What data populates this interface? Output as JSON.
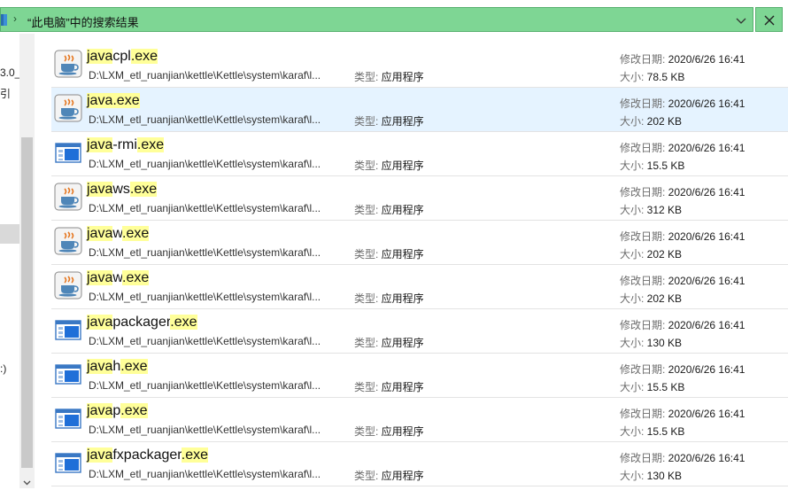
{
  "location": {
    "text": "“此电脑”中的搜索结果",
    "separator": "›"
  },
  "nav": {
    "fragments": [
      "3.0_",
      "引",
      ":)"
    ]
  },
  "labels": {
    "type": "类型: ",
    "modified": "修改日期: ",
    "size": "大小: "
  },
  "files": [
    {
      "name_parts": [
        {
          "t": "java",
          "hl": true
        },
        {
          "t": "cpl",
          "hl": false
        },
        {
          "t": ".exe",
          "hl": true
        }
      ],
      "icon": "java-cup-icon",
      "path": "D:\\LXM_etl_ruanjian\\kettle\\Kettle\\system\\karaf\\l...",
      "type": "应用程序",
      "modified": "2020/6/26 16:41",
      "size": "78.5 KB",
      "selected": false
    },
    {
      "name_parts": [
        {
          "t": "java",
          "hl": true
        },
        {
          "t": ".exe",
          "hl": true
        }
      ],
      "icon": "java-cup-icon",
      "path": "D:\\LXM_etl_ruanjian\\kettle\\Kettle\\system\\karaf\\l...",
      "type": "应用程序",
      "modified": "2020/6/26 16:41",
      "size": "202 KB",
      "selected": true
    },
    {
      "name_parts": [
        {
          "t": "java",
          "hl": true
        },
        {
          "t": "-rmi",
          "hl": false
        },
        {
          "t": ".exe",
          "hl": true
        }
      ],
      "icon": "window-app-icon",
      "path": "D:\\LXM_etl_ruanjian\\kettle\\Kettle\\system\\karaf\\l...",
      "type": "应用程序",
      "modified": "2020/6/26 16:41",
      "size": "15.5 KB",
      "selected": false
    },
    {
      "name_parts": [
        {
          "t": "java",
          "hl": true
        },
        {
          "t": "ws",
          "hl": false
        },
        {
          "t": ".exe",
          "hl": true
        }
      ],
      "icon": "java-cup-icon",
      "path": "D:\\LXM_etl_ruanjian\\kettle\\Kettle\\system\\karaf\\l...",
      "type": "应用程序",
      "modified": "2020/6/26 16:41",
      "size": "312 KB",
      "selected": false
    },
    {
      "name_parts": [
        {
          "t": "java",
          "hl": true
        },
        {
          "t": "w",
          "hl": false
        },
        {
          "t": ".exe",
          "hl": true
        }
      ],
      "icon": "java-cup-icon",
      "path": "D:\\LXM_etl_ruanjian\\kettle\\Kettle\\system\\karaf\\l...",
      "type": "应用程序",
      "modified": "2020/6/26 16:41",
      "size": "202 KB",
      "selected": false
    },
    {
      "name_parts": [
        {
          "t": "java",
          "hl": true
        },
        {
          "t": "w",
          "hl": false
        },
        {
          "t": ".exe",
          "hl": true
        }
      ],
      "icon": "java-cup-icon",
      "path": "D:\\LXM_etl_ruanjian\\kettle\\Kettle\\system\\karaf\\l...",
      "type": "应用程序",
      "modified": "2020/6/26 16:41",
      "size": "202 KB",
      "selected": false
    },
    {
      "name_parts": [
        {
          "t": "java",
          "hl": true
        },
        {
          "t": "packager",
          "hl": false
        },
        {
          "t": ".exe",
          "hl": true
        }
      ],
      "icon": "window-app-icon",
      "path": "D:\\LXM_etl_ruanjian\\kettle\\Kettle\\system\\karaf\\l...",
      "type": "应用程序",
      "modified": "2020/6/26 16:41",
      "size": "130 KB",
      "selected": false
    },
    {
      "name_parts": [
        {
          "t": "java",
          "hl": true
        },
        {
          "t": "h",
          "hl": false
        },
        {
          "t": ".exe",
          "hl": true
        }
      ],
      "icon": "window-app-icon",
      "path": "D:\\LXM_etl_ruanjian\\kettle\\Kettle\\system\\karaf\\l...",
      "type": "应用程序",
      "modified": "2020/6/26 16:41",
      "size": "15.5 KB",
      "selected": false
    },
    {
      "name_parts": [
        {
          "t": "java",
          "hl": true
        },
        {
          "t": "p",
          "hl": false
        },
        {
          "t": ".exe",
          "hl": true
        }
      ],
      "icon": "window-app-icon",
      "path": "D:\\LXM_etl_ruanjian\\kettle\\Kettle\\system\\karaf\\l...",
      "type": "应用程序",
      "modified": "2020/6/26 16:41",
      "size": "15.5 KB",
      "selected": false
    },
    {
      "name_parts": [
        {
          "t": "java",
          "hl": true
        },
        {
          "t": "fxpackager",
          "hl": false
        },
        {
          "t": ".exe",
          "hl": true
        }
      ],
      "icon": "window-app-icon",
      "path": "D:\\LXM_etl_ruanjian\\kettle\\Kettle\\system\\karaf\\l...",
      "type": "应用程序",
      "modified": "2020/6/26 16:41",
      "size": "130 KB",
      "selected": false
    }
  ],
  "colors": {
    "search_bar": "#7ed694",
    "highlight": "#ffff99",
    "selection": "#e5f3ff"
  }
}
